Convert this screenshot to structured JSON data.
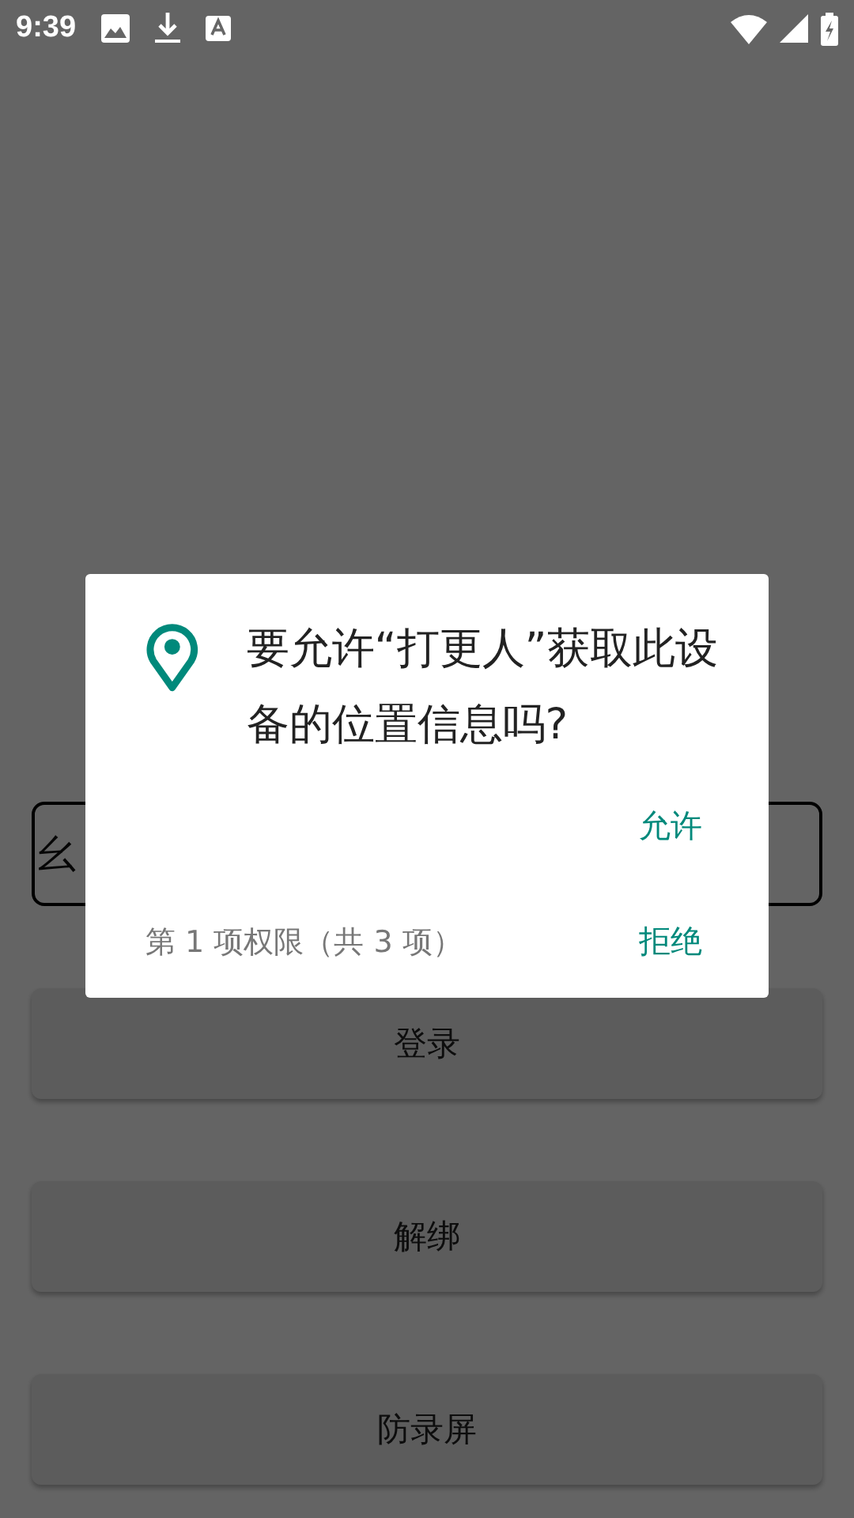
{
  "status_bar": {
    "time": "9:39"
  },
  "form": {
    "field_value": "幺"
  },
  "buttons": [
    {
      "label": "登录"
    },
    {
      "label": "解绑"
    },
    {
      "label": "防录屏"
    }
  ],
  "dialog": {
    "message": "要允许“打更人”获取此设备的位置信息吗?",
    "allow": "允许",
    "counter": "第 1 项权限（共 3 项）",
    "deny": "拒绝"
  }
}
